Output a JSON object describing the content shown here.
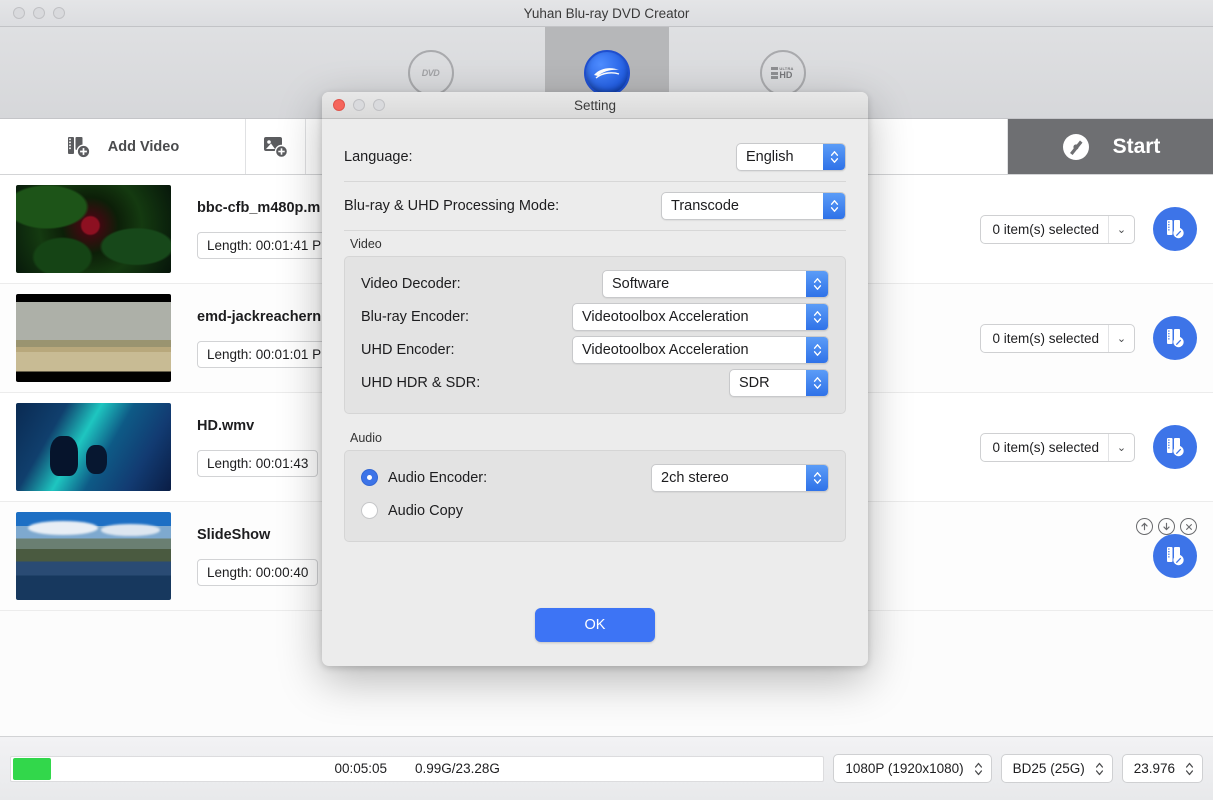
{
  "window": {
    "title": "Yuhan Blu-ray DVD Creator"
  },
  "toolbar": {
    "modes": [
      {
        "id": "dvd",
        "label": "DVD",
        "icon": "dvd-disc-icon",
        "active": false
      },
      {
        "id": "bluray",
        "label": "Blu-ray",
        "icon": "bluray-disc-icon",
        "active": true
      },
      {
        "id": "uhd",
        "label": "Ultra HD",
        "icon": "ultra-hd-disc-icon",
        "active": false
      }
    ]
  },
  "actionbar": {
    "add_video_label": "Add Video",
    "add_video_icon": "film-strip-plus-icon",
    "add_photo_icon": "photo-plus-icon",
    "start_label": "Start",
    "start_icon": "disc-burn-icon"
  },
  "files": [
    {
      "name": "bbc-cfb_m480p.m",
      "length_label": "Length: 00:01:41  P",
      "selected_label": "0 item(s) selected",
      "edit_icon": "film-edit-icon"
    },
    {
      "name": "emd-jackreachern",
      "length_label": "Length: 00:01:01  P",
      "selected_label": "0 item(s) selected",
      "edit_icon": "film-edit-icon"
    },
    {
      "name": "HD.wmv",
      "length_label": "Length: 00:01:43  ",
      "selected_label": "0 item(s) selected",
      "edit_icon": "film-edit-icon"
    },
    {
      "name": "SlideShow",
      "length_label": "Length: 00:00:40",
      "selected_label": "",
      "edit_icon": "film-edit-icon",
      "controls": [
        "move-up-icon",
        "move-down-icon",
        "remove-icon"
      ]
    }
  ],
  "bottombar": {
    "elapsed": "00:05:05",
    "size": "0.99G/23.28G",
    "resolution": "1080P (1920x1080)",
    "disc_type": "BD25 (25G)",
    "framerate": "23.976"
  },
  "dialog": {
    "title": "Setting",
    "language_label": "Language:",
    "language_value": "English",
    "processing_mode_label": "Blu-ray & UHD Processing Mode:",
    "processing_mode_value": "Transcode",
    "video": {
      "group_label": "Video",
      "rows": [
        {
          "label": "Video Decoder:",
          "value": "Software"
        },
        {
          "label": "Blu-ray Encoder:",
          "value": "Videotoolbox Acceleration"
        },
        {
          "label": "UHD Encoder:",
          "value": "Videotoolbox Acceleration"
        },
        {
          "label": "UHD HDR & SDR:",
          "value": "SDR"
        }
      ]
    },
    "audio": {
      "group_label": "Audio",
      "encoder_label": "Audio Encoder:",
      "encoder_value": "2ch stereo",
      "copy_label": "Audio Copy",
      "selected": "encoder"
    },
    "ok_label": "OK"
  },
  "colors": {
    "accent_blue": "#3d74e8",
    "ok_blue": "#3d74f5",
    "progress_green": "#32d74b",
    "start_gray": "#6e6f72"
  }
}
